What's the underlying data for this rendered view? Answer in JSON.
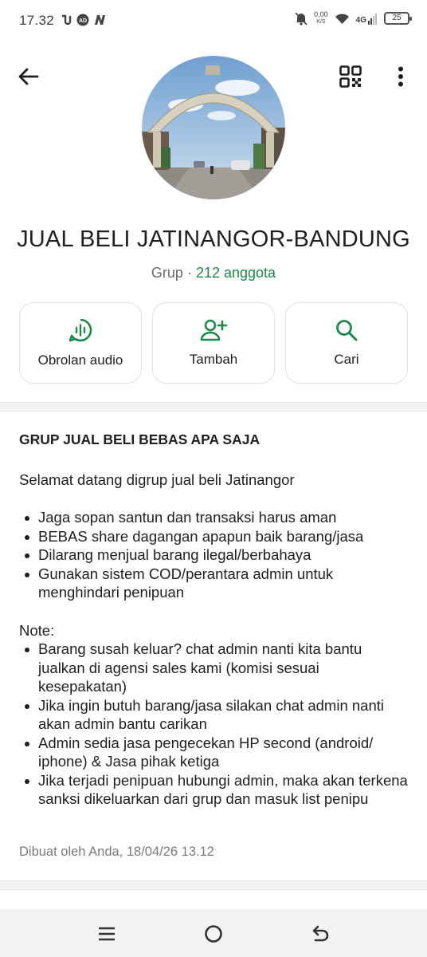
{
  "status_bar": {
    "time": "17.32",
    "net_speed_value": "0,00",
    "net_speed_unit": "K/S",
    "network": "4G",
    "battery": "25"
  },
  "header": {
    "back_icon": "arrow-left-icon",
    "qr_icon": "qr-code-icon",
    "more_icon": "more-vertical-icon"
  },
  "group": {
    "name": "JUAL BELI JATINANGOR-BANDUNG",
    "type": "Grup",
    "separator": " · ",
    "members": "212 anggota"
  },
  "actions": [
    {
      "label": "Obrolan audio",
      "icon": "audio-chat-icon"
    },
    {
      "label": "Tambah",
      "icon": "add-person-icon"
    },
    {
      "label": "Cari",
      "icon": "search-icon"
    }
  ],
  "description": {
    "title": "GRUP JUAL BELI BEBAS APA SAJA",
    "welcome": "Selamat datang digrup jual beli Jatinangor",
    "rules": [
      "Jaga sopan santun dan transaksi harus aman",
      "BEBAS share dagangan apapun baik barang/jasa",
      "Dilarang menjual barang ilegal/berbahaya",
      "Gunakan sistem COD/perantara admin untuk menghindari penipuan"
    ],
    "note_label": "Note:",
    "notes": [
      "Barang susah keluar? chat admin nanti kita bantu jualkan di agensi sales kami (komisi sesuai kesepakatan)",
      "Jika ingin butuh barang/jasa silakan chat admin nanti akan admin bantu carikan",
      "Admin sedia jasa pengecekan HP second (android/ iphone) & Jasa pihak ketiga",
      "Jika terjadi penipuan hubungi admin, maka akan terkena sanksi dikeluarkan dari grup dan masuk list penipu"
    ],
    "created": "Dibuat oleh Anda, 18/04/26 13.12"
  },
  "colors": {
    "accent_green": "#1a8a4a",
    "text_primary": "#1f1f1f",
    "text_secondary": "#6b6b6b"
  },
  "navbar": {
    "menu_icon": "menu-icon",
    "home_icon": "home-circle-icon",
    "back_icon": "back-return-icon"
  }
}
